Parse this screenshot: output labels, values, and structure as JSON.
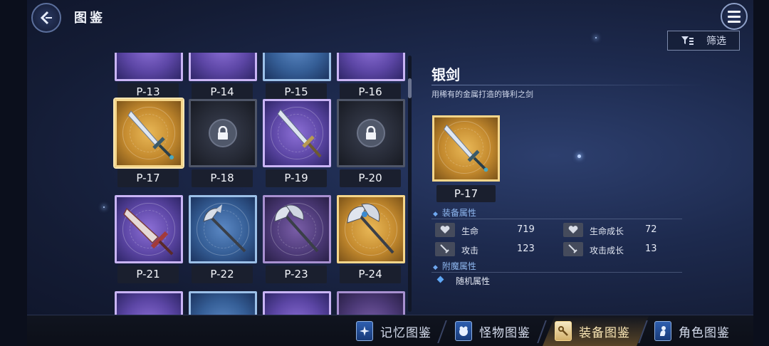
{
  "header": {
    "title": "图鉴"
  },
  "filter": {
    "label": "筛选"
  },
  "grid": {
    "partial_row": [
      "P-13",
      "P-14",
      "P-15",
      "P-16"
    ],
    "cards": [
      {
        "code": "P-17",
        "rarity": "gold",
        "locked": false,
        "weapon": "sword",
        "selected": true
      },
      {
        "code": "P-18",
        "rarity": "locked",
        "locked": true,
        "weapon": "none",
        "selected": false
      },
      {
        "code": "P-19",
        "rarity": "purple",
        "locked": false,
        "weapon": "sword",
        "selected": false
      },
      {
        "code": "P-20",
        "rarity": "locked",
        "locked": true,
        "weapon": "none",
        "selected": false
      },
      {
        "code": "P-21",
        "rarity": "purple",
        "locked": false,
        "weapon": "broadsword",
        "selected": false
      },
      {
        "code": "P-22",
        "rarity": "blue",
        "locked": false,
        "weapon": "axe",
        "selected": false
      },
      {
        "code": "P-23",
        "rarity": "violet",
        "locked": false,
        "weapon": "double-axe",
        "selected": false
      },
      {
        "code": "P-24",
        "rarity": "gold",
        "locked": false,
        "weapon": "double-axe",
        "selected": false
      }
    ]
  },
  "detail": {
    "name": "银剑",
    "description": "用稀有的金属打造的锋利之剑",
    "code": "P-17",
    "equip_section": "装备属性",
    "stats": [
      {
        "icon": "heart-icon",
        "label": "生命",
        "value": "719"
      },
      {
        "icon": "heart-icon",
        "label": "生命成长",
        "value": "72"
      },
      {
        "icon": "sword-icon",
        "label": "攻击",
        "value": "123"
      },
      {
        "icon": "sword-icon",
        "label": "攻击成长",
        "value": "13"
      }
    ],
    "enchant_section": "附魔属性",
    "random_attr": "随机属性"
  },
  "tabs": [
    {
      "label": "记忆图鉴",
      "icon": "memory-icon",
      "active": false
    },
    {
      "label": "怪物图鉴",
      "icon": "monster-icon",
      "active": false
    },
    {
      "label": "装备图鉴",
      "icon": "equipment-icon",
      "active": true
    },
    {
      "label": "角色图鉴",
      "icon": "character-icon",
      "active": false
    }
  ],
  "colors": {
    "gold": "#e9b857",
    "purple": "#8c6fd6",
    "blue": "#5b88c4",
    "active_tab": "#fbe7b5"
  }
}
